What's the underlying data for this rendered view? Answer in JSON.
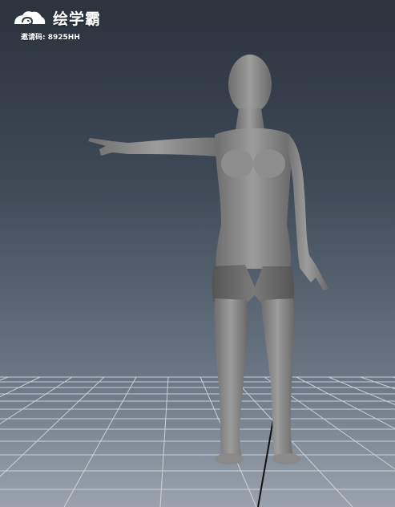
{
  "watermark": {
    "brand_name": "绘学霸",
    "invite_label": "邀请码:",
    "invite_code": "8925HH"
  },
  "scene": {
    "figure": "mannequin-pointing",
    "ground": "perspective-grid"
  },
  "colors": {
    "background_top": "#2b333d",
    "background_bottom": "#9aa3ad",
    "grid_line": "#d8dce1",
    "model_shade": "#8a8a8a",
    "brand_text": "#ffffff"
  }
}
